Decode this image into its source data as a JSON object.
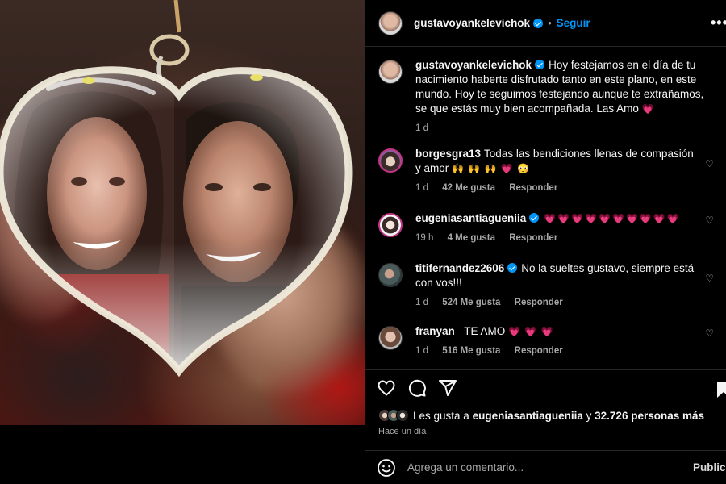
{
  "post": {
    "author": "gustavoyankelevichok",
    "follow_label": "Seguir",
    "separator": "•",
    "more_label": "•••"
  },
  "caption": {
    "username": "gustavoyankelevichok",
    "text": "Hoy festejamos en el día de tu nacimiento haberte disfrutado tanto en este plano, en este mundo. Hoy te seguimos festejando aunque te extrañamos, se que estás muy bien acompañada. Las Amo",
    "emoji": "💗",
    "time": "1 d"
  },
  "comments": [
    {
      "username": "borgesgra13",
      "verified": false,
      "text": "Todas las bendiciones llenas de compasión y amor",
      "emoji": "🙌 🙌 🙌 💗 😳",
      "time": "1 d",
      "likes": "42 Me gusta",
      "reply": "Responder"
    },
    {
      "username": "eugeniasantiagueniia",
      "verified": true,
      "text": "",
      "emoji": "💗💗💗💗💗💗💗💗💗💗",
      "time": "19 h",
      "likes": "4 Me gusta",
      "reply": "Responder"
    },
    {
      "username": "titifernandez2606",
      "verified": true,
      "text": "No la sueltes gustavo, siempre está con vos!!!",
      "emoji": "",
      "time": "1 d",
      "likes": "524 Me gusta",
      "reply": "Responder"
    },
    {
      "username": "franyan_",
      "verified": false,
      "text": "TE AMO",
      "emoji": "💗 💗 💗",
      "time": "1 d",
      "likes": "516 Me gusta",
      "reply": "Responder"
    }
  ],
  "likes_summary": {
    "prefix": "Les gusta a",
    "user": "eugeniasantiagueniia",
    "connector": "y",
    "others": "32.726 personas más"
  },
  "posted_ago": "Hace un día",
  "add_comment": {
    "placeholder": "Agrega un comentario...",
    "publish_label": "Publicar"
  },
  "icons": {
    "like": "heart-icon",
    "comment": "comment-icon",
    "share": "share-icon",
    "save": "bookmark-icon",
    "emoji": "emoji-icon",
    "verified": "verified-badge-icon"
  },
  "colors": {
    "accent": "#0095f6",
    "background": "#000000",
    "text": "#f5f5f5",
    "muted": "#a8a8a8"
  }
}
